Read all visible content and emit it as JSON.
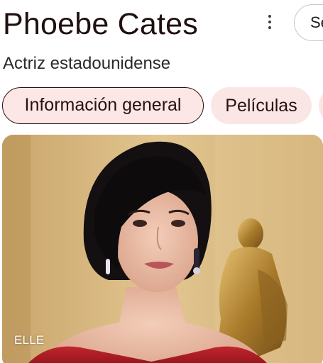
{
  "header": {
    "title": "Phoebe Cates",
    "subtitle": "Actriz estadounidense",
    "save_chip_label": "Seguir"
  },
  "tabs": [
    {
      "label": "Información general",
      "active": true
    },
    {
      "label": "Películas",
      "active": false
    },
    {
      "label": "",
      "active": false
    }
  ],
  "image": {
    "source_label": "ELLE"
  },
  "colors": {
    "title_text": "#1f1010",
    "active_chip_bg": "#fde6e6",
    "chip_bg": "#fbe6e6",
    "photo_background": "#d8b77e"
  },
  "icons": {
    "more": "more-vert-icon"
  }
}
